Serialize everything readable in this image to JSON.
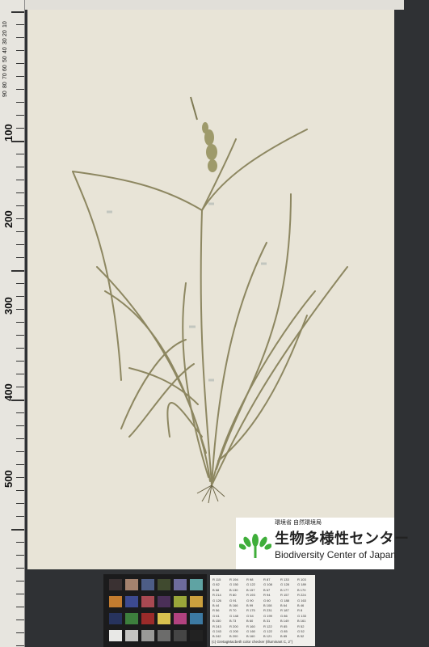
{
  "ruler": {
    "major_labels": [
      "100",
      "200",
      "300",
      "400",
      "500"
    ],
    "minor_labels": [
      "10",
      "20",
      "30",
      "40",
      "50",
      "60",
      "70",
      "80",
      "90"
    ]
  },
  "institution": {
    "agency": "環境省 自然環境局",
    "name_jp": "生物多様性センター",
    "name_en": "Biodiversity Center of Japan"
  },
  "color_chart": {
    "swatch_colors": [
      "#3a3132",
      "#a4826e",
      "#4d5d86",
      "#404a2f",
      "#6d6b9c",
      "#5fa3a3",
      "#c27c2f",
      "#3c4a90",
      "#a84952",
      "#4a2f57",
      "#9aa63a",
      "#cba03e",
      "#27335d",
      "#3d7f3d",
      "#9b2b2a",
      "#d8c14f",
      "#b2427f",
      "#3c79a2",
      "#e8e8e6",
      "#c4c4c2",
      "#9a9a98",
      "#6c6c6b",
      "#454545",
      "#222222"
    ],
    "table_rows": [
      [
        "R 115",
        "R 194",
        "R 98",
        "R 87",
        "R 133",
        "R 103"
      ],
      [
        "G 82",
        "G 150",
        "G 122",
        "G 108",
        "G 128",
        "G 189"
      ],
      [
        "B 68",
        "B 130",
        "B 157",
        "B 67",
        "B 177",
        "B 170"
      ],
      [
        "R 214",
        "R 80",
        "R 193",
        "R 94",
        "R 157",
        "R 224"
      ],
      [
        "G 126",
        "G 91",
        "G 90",
        "G 60",
        "G 188",
        "G 163"
      ],
      [
        "B 44",
        "B 166",
        "B 99",
        "B 108",
        "B 64",
        "B 46"
      ],
      [
        "R 56",
        "R 70",
        "R 175",
        "R 231",
        "R 187",
        "R 8"
      ],
      [
        "G 61",
        "G 148",
        "G 54",
        "G 199",
        "G 86",
        "G 133"
      ],
      [
        "B 150",
        "B 73",
        "B 60",
        "B 31",
        "B 149",
        "B 161"
      ],
      [
        "R 243",
        "R 200",
        "R 160",
        "R 122",
        "R 85",
        "R 52"
      ],
      [
        "G 243",
        "G 200",
        "G 160",
        "G 122",
        "G 85",
        "G 52"
      ],
      [
        "B 242",
        "B 200",
        "B 160",
        "B 121",
        "B 85",
        "B 52"
      ]
    ],
    "caption": "(c) GretagMacbeth color checker (Illuminant C, 2°)"
  }
}
